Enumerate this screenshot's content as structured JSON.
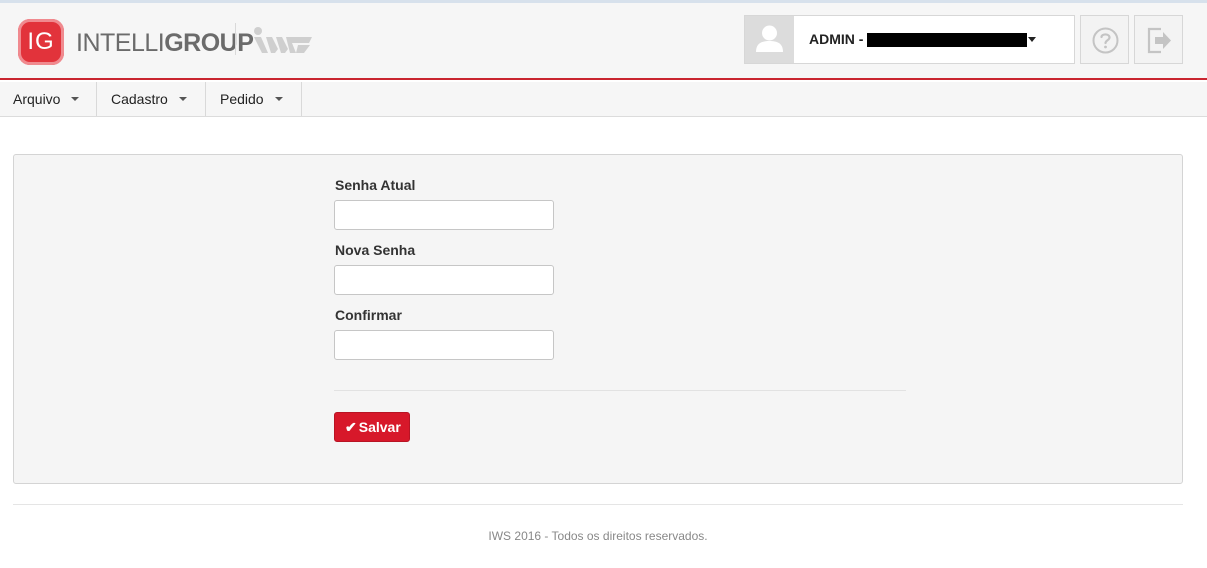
{
  "header": {
    "logo_badge": "IG",
    "logo_light": "INTELLI",
    "logo_bold": "GROUP",
    "user_name": "ADMIN -",
    "brand_color": "#d7182a",
    "icons": [
      "user-avatar-icon",
      "help-icon",
      "logout-icon"
    ]
  },
  "menu": {
    "items": [
      {
        "label": "Arquivo"
      },
      {
        "label": "Cadastro"
      },
      {
        "label": "Pedido"
      }
    ]
  },
  "form": {
    "current_password_label": "Senha Atual",
    "current_password_value": "",
    "new_password_label": "Nova Senha",
    "new_password_value": "",
    "confirm_label": "Confirmar",
    "confirm_value": "",
    "save_label": "Salvar"
  },
  "footer": {
    "text": "IWS 2016 - Todos os direitos reservados."
  }
}
